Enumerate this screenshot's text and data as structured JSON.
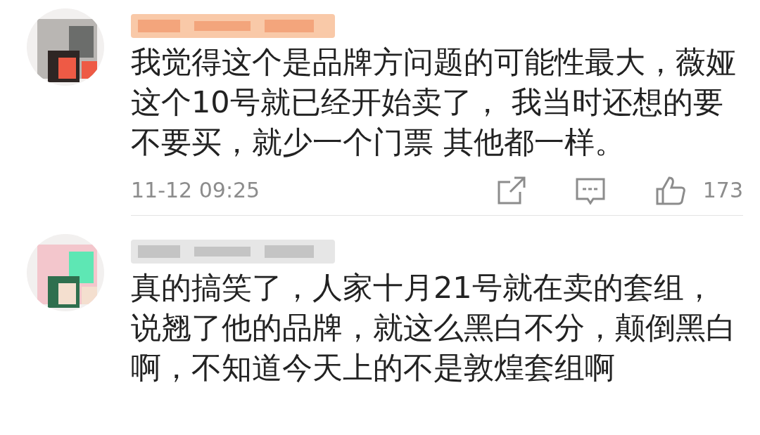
{
  "comments": [
    {
      "text": "我觉得这个是品牌方问题的可能性最大，薇娅这个10号就已经开始卖了， 我当时还想的要不要买，就少一个门票 其他都一样。",
      "time": "11-12 09:25",
      "likes": "173"
    },
    {
      "text": "真的搞笑了，人家十月21号就在卖的套组，说翘了他的品牌，就这么黑白不分，颠倒黑白啊，不知道今天上的不是敦煌套组啊"
    }
  ]
}
